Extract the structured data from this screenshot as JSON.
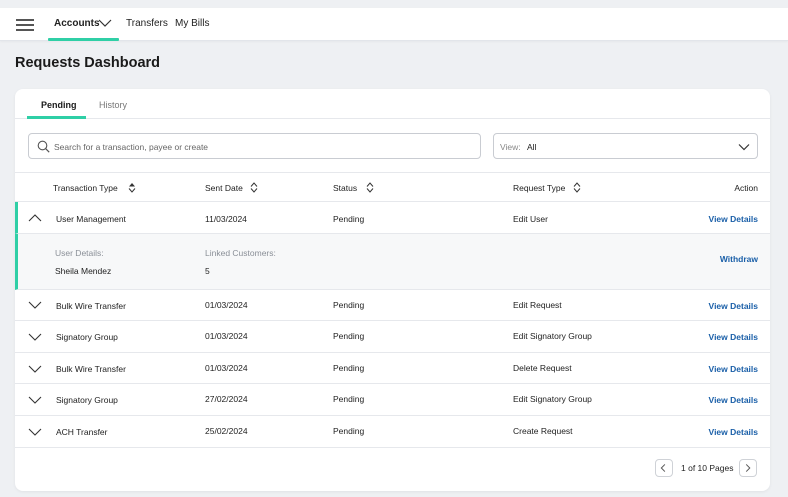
{
  "nav": {
    "items": [
      {
        "label": "Accounts"
      },
      {
        "label": "Transfers"
      },
      {
        "label": "My Bills"
      }
    ]
  },
  "page": {
    "title": "Requests Dashboard"
  },
  "tabs": [
    {
      "label": "Pending",
      "active": true
    },
    {
      "label": "History",
      "active": false
    }
  ],
  "search": {
    "placeholder": "Search for a transaction, payee or create"
  },
  "view": {
    "label": "View:",
    "value": "All"
  },
  "table": {
    "columns": [
      {
        "label": "Transaction Type"
      },
      {
        "label": "Sent Date"
      },
      {
        "label": "Status"
      },
      {
        "label": "Request Type"
      },
      {
        "label": "Action"
      }
    ],
    "rows": [
      {
        "type": "User Management",
        "date": "11/03/2024",
        "status": "Pending",
        "request": "Edit User",
        "action": "View Details",
        "expanded": true
      },
      {
        "type": "Bulk Wire Transfer",
        "date": "01/03/2024",
        "status": "Pending",
        "request": "Edit Request",
        "action": "View Details"
      },
      {
        "type": "Signatory Group",
        "date": "01/03/2024",
        "status": "Pending",
        "request": "Edit Signatory Group",
        "action": "View Details"
      },
      {
        "type": "Bulk Wire Transfer",
        "date": "01/03/2024",
        "status": "Pending",
        "request": "Delete Request",
        "action": "View Details"
      },
      {
        "type": "Signatory Group",
        "date": "27/02/2024",
        "status": "Pending",
        "request": "Edit Signatory Group",
        "action": "View Details"
      },
      {
        "type": "ACH Transfer",
        "date": "25/02/2024",
        "status": "Pending",
        "request": "Create Request",
        "action": "View Details"
      }
    ],
    "detail": {
      "user_label": "User Details:",
      "user_value": "Sheila Mendez",
      "linked_label": "Linked Customers:",
      "linked_value": "5",
      "action": "Withdraw"
    }
  },
  "pagination": {
    "text": "1 of 10 Pages"
  },
  "colors": {
    "accent": "#2fcfa6",
    "link": "#1a5fa8"
  }
}
